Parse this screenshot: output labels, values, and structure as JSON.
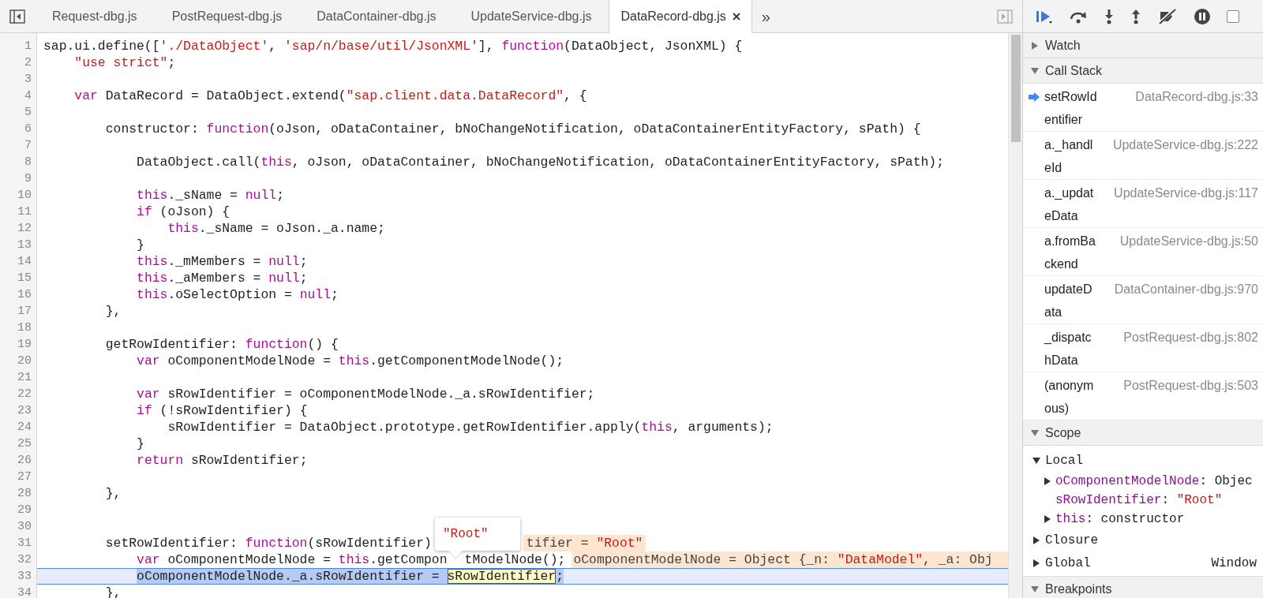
{
  "editor": {
    "tabs": [
      {
        "label": "Request-dbg.js",
        "selected": false
      },
      {
        "label": "PostRequest-dbg.js",
        "selected": false
      },
      {
        "label": "DataContainer-dbg.js",
        "selected": false
      },
      {
        "label": "UpdateService-dbg.js",
        "selected": false
      },
      {
        "label": "DataRecord-dbg.js",
        "selected": true
      }
    ],
    "more_tabs": "»",
    "lines": [
      {
        "number": "1",
        "current": false,
        "tokens": [
          {
            "kind": "plain",
            "text": "sap.ui.define(["
          },
          {
            "kind": "string",
            "text": "'./DataObject'"
          },
          {
            "kind": "plain",
            "text": ", "
          },
          {
            "kind": "string",
            "text": "'sap/n/base/util/JsonXML'"
          },
          {
            "kind": "plain",
            "text": "], "
          },
          {
            "kind": "keyword",
            "text": "function"
          },
          {
            "kind": "plain",
            "text": "(DataObject, JsonXML) {"
          }
        ]
      },
      {
        "number": "2",
        "current": false,
        "tokens": [
          {
            "kind": "string",
            "text": "    \"use strict\""
          },
          {
            "kind": "plain",
            "text": ";"
          }
        ]
      },
      {
        "number": "3",
        "current": false
      },
      {
        "number": "4",
        "current": false,
        "tokens": [
          {
            "kind": "keyword",
            "text": "    var"
          },
          {
            "kind": "plain",
            "text": " DataRecord = DataObject.extend("
          },
          {
            "kind": "string",
            "text": "\"sap.client.data.DataRecord\""
          },
          {
            "kind": "plain",
            "text": ", {"
          }
        ]
      },
      {
        "number": "5",
        "current": false
      },
      {
        "number": "6",
        "current": false,
        "tokens": [
          {
            "kind": "plain",
            "text": "        constructor: "
          },
          {
            "kind": "keyword",
            "text": "function"
          },
          {
            "kind": "plain",
            "text": "(oJson, oDataContainer, bNoChangeNotification, oDataContainerEntityFactory, sPath) {"
          }
        ]
      },
      {
        "number": "7",
        "current": false
      },
      {
        "number": "8",
        "current": false,
        "tokens": [
          {
            "kind": "plain",
            "text": "            DataObject.call("
          },
          {
            "kind": "keyword",
            "text": "this"
          },
          {
            "kind": "plain",
            "text": ", oJson, oDataContainer, bNoChangeNotification, oDataContainerEntityFactory, sPath);"
          }
        ]
      },
      {
        "number": "9",
        "current": false
      },
      {
        "number": "10",
        "current": false,
        "tokens": [
          {
            "kind": "keyword",
            "text": "            this"
          },
          {
            "kind": "plain",
            "text": "._sName = "
          },
          {
            "kind": "keyword",
            "text": "null"
          },
          {
            "kind": "plain",
            "text": ";"
          }
        ]
      },
      {
        "number": "11",
        "current": false,
        "tokens": [
          {
            "kind": "keyword",
            "text": "            if"
          },
          {
            "kind": "plain",
            "text": " (oJson) {"
          }
        ]
      },
      {
        "number": "12",
        "current": false,
        "tokens": [
          {
            "kind": "keyword",
            "text": "                this"
          },
          {
            "kind": "plain",
            "text": "._sName = oJson._a.name;"
          }
        ]
      },
      {
        "number": "13",
        "current": false,
        "tokens": [
          {
            "kind": "plain",
            "text": "            }"
          }
        ]
      },
      {
        "number": "14",
        "current": false,
        "tokens": [
          {
            "kind": "keyword",
            "text": "            this"
          },
          {
            "kind": "plain",
            "text": "._mMembers = "
          },
          {
            "kind": "keyword",
            "text": "null"
          },
          {
            "kind": "plain",
            "text": ";"
          }
        ]
      },
      {
        "number": "15",
        "current": false,
        "tokens": [
          {
            "kind": "keyword",
            "text": "            this"
          },
          {
            "kind": "plain",
            "text": "._aMembers = "
          },
          {
            "kind": "keyword",
            "text": "null"
          },
          {
            "kind": "plain",
            "text": ";"
          }
        ]
      },
      {
        "number": "16",
        "current": false,
        "tokens": [
          {
            "kind": "keyword",
            "text": "            this"
          },
          {
            "kind": "plain",
            "text": ".oSelectOption = "
          },
          {
            "kind": "keyword",
            "text": "null"
          },
          {
            "kind": "plain",
            "text": ";"
          }
        ]
      },
      {
        "number": "17",
        "current": false,
        "tokens": [
          {
            "kind": "plain",
            "text": "        },"
          }
        ]
      },
      {
        "number": "18",
        "current": false
      },
      {
        "number": "19",
        "current": false,
        "tokens": [
          {
            "kind": "plain",
            "text": "        getRowIdentifier: "
          },
          {
            "kind": "keyword",
            "text": "function"
          },
          {
            "kind": "plain",
            "text": "() {"
          }
        ]
      },
      {
        "number": "20",
        "current": false,
        "tokens": [
          {
            "kind": "keyword",
            "text": "            var"
          },
          {
            "kind": "plain",
            "text": " oComponentModelNode = "
          },
          {
            "kind": "keyword",
            "text": "this"
          },
          {
            "kind": "plain",
            "text": ".getComponentModelNode();"
          }
        ]
      },
      {
        "number": "21",
        "current": false
      },
      {
        "number": "22",
        "current": false,
        "tokens": [
          {
            "kind": "keyword",
            "text": "            var"
          },
          {
            "kind": "plain",
            "text": " sRowIdentifier = oComponentModelNode._a.sRowIdentifier;"
          }
        ]
      },
      {
        "number": "23",
        "current": false,
        "tokens": [
          {
            "kind": "keyword",
            "text": "            if"
          },
          {
            "kind": "plain",
            "text": " (!sRowIdentifier) {"
          }
        ]
      },
      {
        "number": "24",
        "current": false,
        "tokens": [
          {
            "kind": "plain",
            "text": "                sRowIdentifier = DataObject.prototype.getRowIdentifier.apply("
          },
          {
            "kind": "keyword",
            "text": "this"
          },
          {
            "kind": "plain",
            "text": ", arguments);"
          }
        ]
      },
      {
        "number": "25",
        "current": false,
        "tokens": [
          {
            "kind": "plain",
            "text": "            }"
          }
        ]
      },
      {
        "number": "26",
        "current": false,
        "tokens": [
          {
            "kind": "keyword",
            "text": "            return"
          },
          {
            "kind": "plain",
            "text": " sRowIdentifier;"
          }
        ]
      },
      {
        "number": "27",
        "current": false
      },
      {
        "number": "28",
        "current": false,
        "tokens": [
          {
            "kind": "plain",
            "text": "        },"
          }
        ]
      },
      {
        "number": "29",
        "current": false
      },
      {
        "number": "30",
        "current": false
      },
      {
        "number": "31",
        "current": false,
        "tokens": [
          {
            "kind": "plain",
            "text": "        setRowIdentifier: "
          },
          {
            "kind": "keyword",
            "text": "function"
          },
          {
            "kind": "plain",
            "text": "(sRowIdentifier)"
          }
        ],
        "inline_value": [
          {
            "kind": "plain",
            "text": "tifier = "
          },
          {
            "kind": "string",
            "text": "\"Root\""
          }
        ]
      },
      {
        "number": "32",
        "current": false,
        "tokens": [
          {
            "kind": "keyword",
            "text": "            var"
          },
          {
            "kind": "plain",
            "text": " oComponentModelNode = "
          },
          {
            "kind": "keyword",
            "text": "this"
          },
          {
            "kind": "plain",
            "text": ".getCompon"
          }
        ],
        "after_popover": [
          {
            "kind": "plain",
            "text": "tModelNode();"
          }
        ],
        "inline_value": [
          {
            "kind": "plain",
            "text": "oComponentModelNode = Object {_n: "
          },
          {
            "kind": "string",
            "text": "\"DataModel\""
          },
          {
            "kind": "plain",
            "text": ", _a: Obj"
          }
        ]
      },
      {
        "number": "33",
        "current": true,
        "tokens": [
          {
            "kind": "selected",
            "text": "            oComponentModelNode._a.sRowIdentifier = "
          },
          {
            "kind": "hovered",
            "text": "sRowIdentifier"
          },
          {
            "kind": "selected",
            "text": ";"
          }
        ]
      },
      {
        "number": "34",
        "current": false,
        "tokens": [
          {
            "kind": "plain",
            "text": "        },"
          }
        ]
      }
    ],
    "popover": {
      "value": "\"Root\""
    }
  },
  "debugger": {
    "toolbar_checkbox": {
      "checked": false
    },
    "sections": [
      {
        "title": "Watch",
        "expanded": false
      },
      {
        "title": "Call Stack",
        "expanded": true,
        "frames": [
          {
            "function": "setRowIdentifier",
            "location": "DataRecord-dbg.js:33",
            "current": true
          },
          {
            "function": "a._handleId",
            "location": "UpdateService-dbg.js:222",
            "current": false
          },
          {
            "function": "a._updateData",
            "location": "UpdateService-dbg.js:117",
            "current": false
          },
          {
            "function": "a.fromBackend",
            "location": "UpdateService-dbg.js:50",
            "current": false
          },
          {
            "function": "updateData",
            "location": "DataContainer-dbg.js:970",
            "current": false
          },
          {
            "function": "_dispatchData",
            "location": "PostRequest-dbg.js:802",
            "current": false
          },
          {
            "function": "(anonymous)",
            "location": "PostRequest-dbg.js:503",
            "current": false
          }
        ]
      },
      {
        "title": "Scope",
        "expanded": true,
        "items": [
          {
            "name": "Local",
            "expanded": true,
            "children": [
              {
                "name": "oComponentModelNode",
                "separator": ":",
                "kind": "object",
                "expanded": false,
                "value": "Objec"
              },
              {
                "name": "sRowIdentifier",
                "separator": ":",
                "kind": "string",
                "value": "\"Root\""
              },
              {
                "name": "this",
                "separator": ":",
                "kind": "object",
                "expanded": false,
                "value": "constructor"
              }
            ]
          },
          {
            "name": "Closure",
            "expanded": false
          },
          {
            "name": "Global",
            "expanded": false,
            "value": "Window"
          }
        ]
      },
      {
        "title": "Breakpoints",
        "expanded": true
      }
    ]
  }
}
